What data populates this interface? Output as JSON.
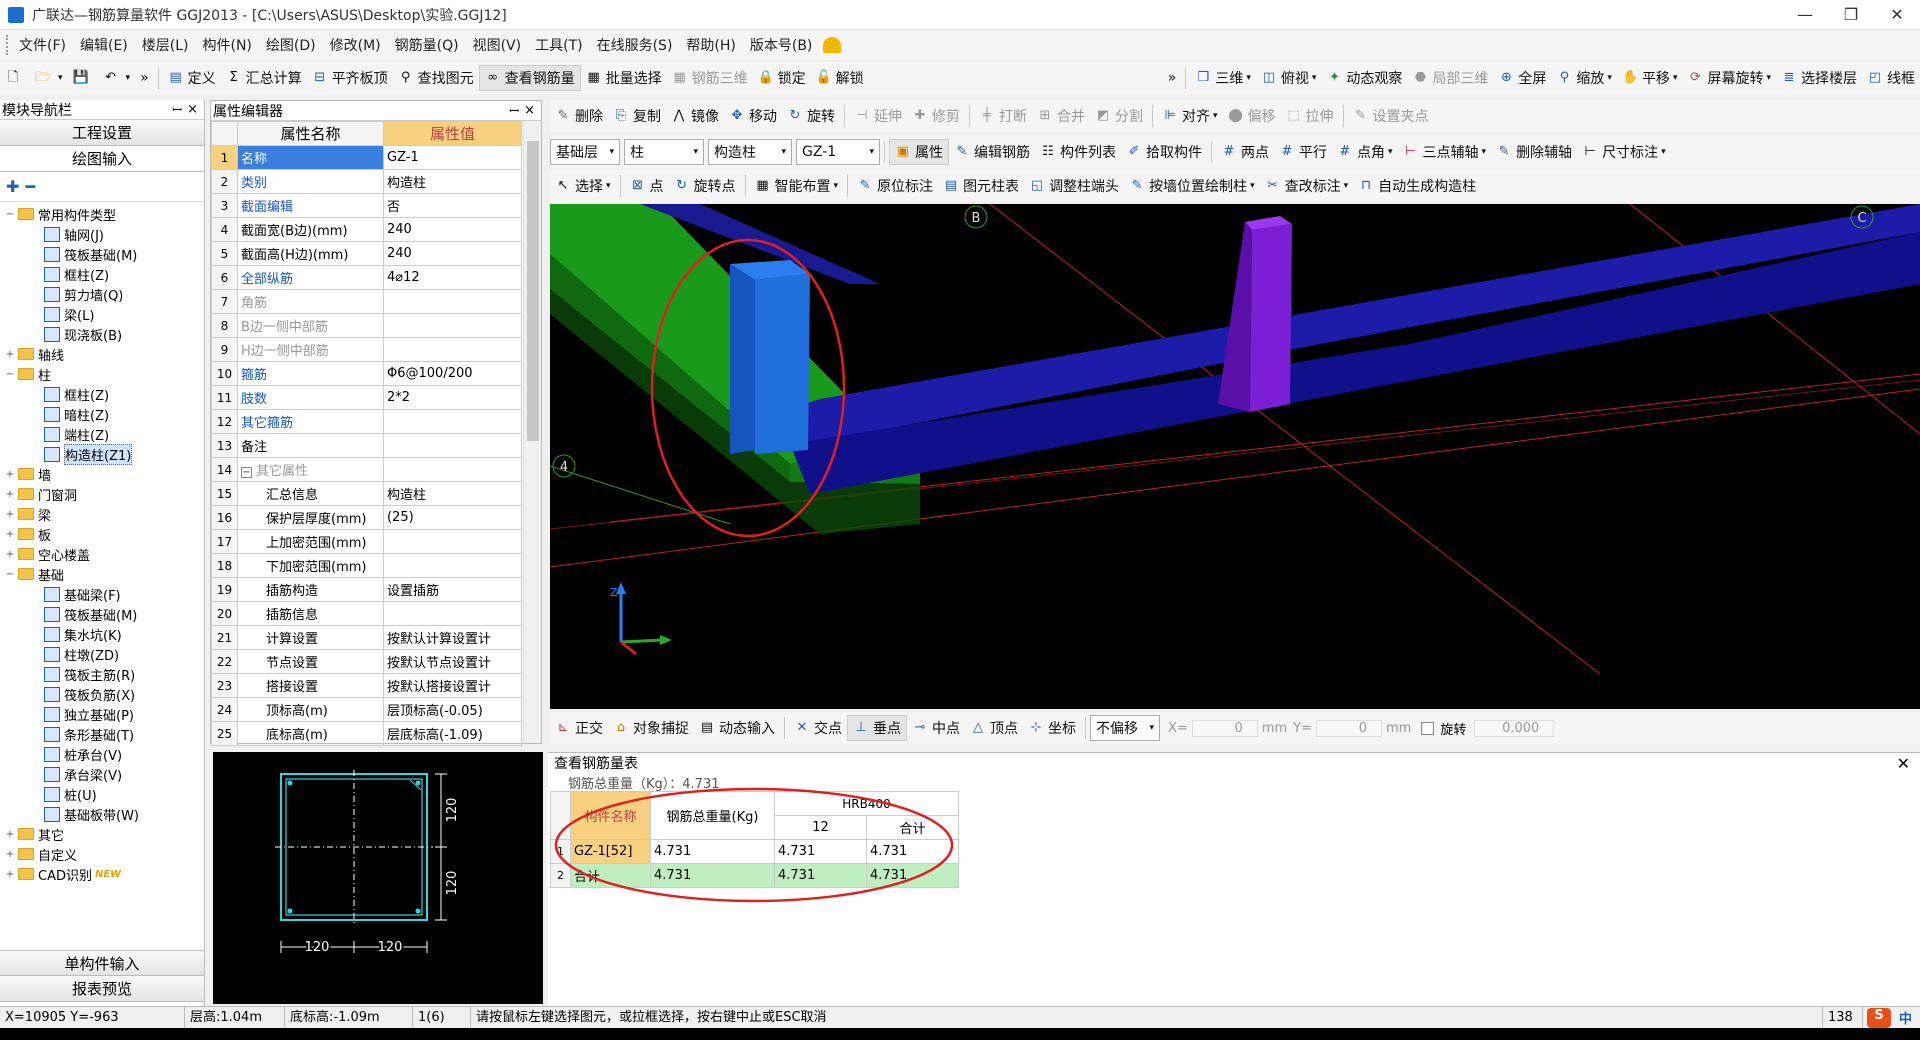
{
  "window": {
    "title": "广联达—钢筋算量软件 GGJ2013 - [C:\\Users\\ASUS\\Desktop\\实验.GGJ12]",
    "min": "—",
    "max": "❐",
    "close": "✕"
  },
  "menu": [
    "文件(F)",
    "编辑(E)",
    "楼层(L)",
    "构件(N)",
    "绘图(D)",
    "修改(M)",
    "钢筋量(Q)",
    "视图(V)",
    "工具(T)",
    "在线服务(S)",
    "帮助(H)",
    "版本号(B)"
  ],
  "toolbar1": {
    "left": [
      "定义",
      "汇总计算",
      "平齐板顶",
      "查找图元",
      "查看钢筋量",
      "批量选择",
      "钢筋三维",
      "锁定",
      "解锁"
    ],
    "right": [
      "三维",
      "俯视",
      "动态观察",
      "局部三维",
      "全屏",
      "缩放",
      "平移",
      "屏幕旋转",
      "选择楼层",
      "线框"
    ],
    "more": "»"
  },
  "toolbar2": [
    "删除",
    "复制",
    "镜像",
    "移动",
    "旋转",
    "延伸",
    "修剪",
    "打断",
    "合并",
    "分割",
    "对齐",
    "偏移",
    "拉伸",
    "设置夹点"
  ],
  "toolbar3": {
    "floor": "基础层",
    "type": "柱",
    "subtype": "构造柱",
    "item": "GZ-1",
    "buttons": [
      "属性",
      "编辑钢筋",
      "构件列表",
      "拾取构件",
      "两点",
      "平行",
      "点角",
      "三点辅轴",
      "删除辅轴",
      "尺寸标注"
    ]
  },
  "toolbar4": [
    "选择",
    "点",
    "旋转点",
    "智能布置",
    "原位标注",
    "图元柱表",
    "调整柱端头",
    "按墙位置绘制柱",
    "查改标注",
    "自动生成构造柱"
  ],
  "nav": {
    "title": "模块导航栏",
    "pin": "ꟷ",
    "close": "×",
    "btn_project": "工程设置",
    "btn_draw": "绘图输入",
    "btn_single": "单构件输入",
    "btn_report": "报表预览",
    "tree": [
      {
        "lvl": 0,
        "exp": "−",
        "kind": "folder",
        "label": "常用构件类型"
      },
      {
        "lvl": 1,
        "kind": "comp",
        "label": "轴网(J)"
      },
      {
        "lvl": 1,
        "kind": "comp",
        "label": "筏板基础(M)"
      },
      {
        "lvl": 1,
        "kind": "comp",
        "label": "框柱(Z)"
      },
      {
        "lvl": 1,
        "kind": "comp",
        "label": "剪力墙(Q)"
      },
      {
        "lvl": 1,
        "kind": "comp",
        "label": "梁(L)"
      },
      {
        "lvl": 1,
        "kind": "comp",
        "label": "现浇板(B)"
      },
      {
        "lvl": 0,
        "exp": "+",
        "kind": "folder",
        "label": "轴线"
      },
      {
        "lvl": 0,
        "exp": "−",
        "kind": "folder",
        "label": "柱"
      },
      {
        "lvl": 1,
        "kind": "comp",
        "label": "框柱(Z)"
      },
      {
        "lvl": 1,
        "kind": "comp",
        "label": "暗柱(Z)"
      },
      {
        "lvl": 1,
        "kind": "comp",
        "label": "端柱(Z)"
      },
      {
        "lvl": 1,
        "kind": "comp",
        "label": "构造柱(Z1)",
        "sel": true
      },
      {
        "lvl": 0,
        "exp": "+",
        "kind": "folder",
        "label": "墙"
      },
      {
        "lvl": 0,
        "exp": "+",
        "kind": "folder",
        "label": "门窗洞"
      },
      {
        "lvl": 0,
        "exp": "+",
        "kind": "folder",
        "label": "梁"
      },
      {
        "lvl": 0,
        "exp": "+",
        "kind": "folder",
        "label": "板"
      },
      {
        "lvl": 0,
        "exp": "+",
        "kind": "folder",
        "label": "空心楼盖"
      },
      {
        "lvl": 0,
        "exp": "−",
        "kind": "folder",
        "label": "基础"
      },
      {
        "lvl": 1,
        "kind": "comp",
        "label": "基础梁(F)"
      },
      {
        "lvl": 1,
        "kind": "comp",
        "label": "筏板基础(M)"
      },
      {
        "lvl": 1,
        "kind": "comp",
        "label": "集水坑(K)"
      },
      {
        "lvl": 1,
        "kind": "comp",
        "label": "柱墩(ZD)"
      },
      {
        "lvl": 1,
        "kind": "comp",
        "label": "筏板主筋(R)"
      },
      {
        "lvl": 1,
        "kind": "comp",
        "label": "筏板负筋(X)"
      },
      {
        "lvl": 1,
        "kind": "comp",
        "label": "独立基础(P)"
      },
      {
        "lvl": 1,
        "kind": "comp",
        "label": "条形基础(T)"
      },
      {
        "lvl": 1,
        "kind": "comp",
        "label": "桩承台(V)"
      },
      {
        "lvl": 1,
        "kind": "comp",
        "label": "承台梁(V)"
      },
      {
        "lvl": 1,
        "kind": "comp",
        "label": "桩(U)"
      },
      {
        "lvl": 1,
        "kind": "comp",
        "label": "基础板带(W)"
      },
      {
        "lvl": 0,
        "exp": "+",
        "kind": "folder",
        "label": "其它"
      },
      {
        "lvl": 0,
        "exp": "+",
        "kind": "folder",
        "label": "自定义"
      },
      {
        "lvl": 0,
        "exp": "+",
        "kind": "folder",
        "label": "CAD识别",
        "badge": "NEW"
      }
    ]
  },
  "props": {
    "title": "属性编辑器",
    "col_name": "属性名称",
    "col_value": "属性值",
    "rows": [
      {
        "n": "1",
        "name": "名称",
        "value": "GZ-1",
        "style": "blue",
        "sel": true
      },
      {
        "n": "2",
        "name": "类别",
        "value": "构造柱",
        "style": "blue"
      },
      {
        "n": "3",
        "name": "截面编辑",
        "value": "否",
        "style": "blue"
      },
      {
        "n": "4",
        "name": "截面宽(B边)(mm)",
        "value": "240",
        "style": ""
      },
      {
        "n": "5",
        "name": "截面高(H边)(mm)",
        "value": "240",
        "style": ""
      },
      {
        "n": "6",
        "name": "全部纵筋",
        "value": "4⌀12",
        "style": "blue"
      },
      {
        "n": "7",
        "name": "角筋",
        "value": "",
        "style": "gray"
      },
      {
        "n": "8",
        "name": "B边一侧中部筋",
        "value": "",
        "style": "gray"
      },
      {
        "n": "9",
        "name": "H边一侧中部筋",
        "value": "",
        "style": "gray"
      },
      {
        "n": "10",
        "name": "箍筋",
        "value": "Φ6@100/200",
        "style": "blue"
      },
      {
        "n": "11",
        "name": "肢数",
        "value": "2*2",
        "style": "blue"
      },
      {
        "n": "12",
        "name": "其它箍筋",
        "value": "",
        "style": "blue"
      },
      {
        "n": "13",
        "name": "备注",
        "value": "",
        "style": ""
      },
      {
        "n": "14",
        "name": "其它属性",
        "value": "",
        "style": "gray",
        "group": "−"
      },
      {
        "n": "15",
        "name": "汇总信息",
        "value": "构造柱",
        "style": "ind"
      },
      {
        "n": "16",
        "name": "保护层厚度(mm)",
        "value": "(25)",
        "style": "ind"
      },
      {
        "n": "17",
        "name": "上加密范围(mm)",
        "value": "",
        "style": "ind"
      },
      {
        "n": "18",
        "name": "下加密范围(mm)",
        "value": "",
        "style": "ind"
      },
      {
        "n": "19",
        "name": "插筋构造",
        "value": "设置插筋",
        "style": "ind"
      },
      {
        "n": "20",
        "name": "插筋信息",
        "value": "",
        "style": "ind"
      },
      {
        "n": "21",
        "name": "计算设置",
        "value": "按默认计算设置计",
        "style": "ind"
      },
      {
        "n": "22",
        "name": "节点设置",
        "value": "按默认节点设置计",
        "style": "ind"
      },
      {
        "n": "23",
        "name": "搭接设置",
        "value": "按默认搭接设置计",
        "style": "ind"
      },
      {
        "n": "24",
        "name": "顶标高(m)",
        "value": "层顶标高(-0.05)",
        "style": "ind"
      },
      {
        "n": "25",
        "name": "底标高(m)",
        "value": "层底标高(-1.09)",
        "style": "ind"
      }
    ]
  },
  "section": {
    "dim_h_top": "120",
    "dim_h_bottom": "120",
    "dim_w_left": "120",
    "dim_w_right": "120"
  },
  "viewport": {
    "axis_labels": [
      "B",
      "C",
      "4"
    ],
    "axis_z": "Z"
  },
  "snap": {
    "buttons": [
      "正交",
      "对象捕捉",
      "动态输入",
      "交点",
      "垂点",
      "中点",
      "顶点",
      "坐标"
    ],
    "offset": "不偏移",
    "x_label": "X=",
    "x_val": "0",
    "unit1": "mm",
    "y_label": "Y=",
    "y_val": "0",
    "unit2": "mm",
    "rotate": "旋转",
    "angle": "0.000"
  },
  "rebar": {
    "title": "查看钢筋量表",
    "close": "✕",
    "total_label": "钢筋总重量（Kg）：4.731",
    "headers": {
      "name": "构件名称",
      "weight": "钢筋总重量(Kg)",
      "grade": "HRB400",
      "d12": "12",
      "sum": "合计"
    },
    "rows": [
      {
        "n": "1",
        "name": "GZ-1[52]",
        "weight": "4.731",
        "d12": "4.731",
        "sum": "4.731"
      },
      {
        "n": "2",
        "name": "合计",
        "weight": "4.731",
        "d12": "4.731",
        "sum": "4.731"
      }
    ]
  },
  "status": {
    "coords": "X=10905 Y=-963",
    "floor_h": "层高:1.04m",
    "bottom_h": "底标高:-1.09m",
    "sel": "1(6)",
    "hint": "请按鼠标左键选择图元，或拉框选择，按右键中止或ESC取消",
    "right_num": "138",
    "ime": "中"
  },
  "colors": {
    "accent_sel": "#3a7ee0",
    "header_orange": "#f7d080",
    "annot_red": "#e02020",
    "beam_blue": "#1a1aa8",
    "column_blue": "#1f6fdc",
    "column_purple": "#7a1fd6",
    "beam_green": "#1f8a1f"
  }
}
